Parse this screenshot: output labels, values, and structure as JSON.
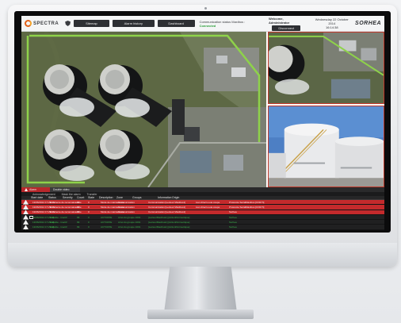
{
  "app": {
    "brand_logo": "SPECTRA",
    "vendor_logo": "SORHEA",
    "accent": "#e2621b"
  },
  "nav": {
    "synoptic": "Sitemap",
    "history": "Alarm history",
    "dashboard": "Dashboard"
  },
  "status": {
    "label": "Communication status Maxibus :",
    "value": "Connected",
    "value_color": "#2c9e3a"
  },
  "user": {
    "welcome": "Welcome, Administrator",
    "disconnect": "Disconnect"
  },
  "datetime": {
    "date": "Wednesday 22 October 2014",
    "time": "16:14:38"
  },
  "alarm_panel": {
    "tabs": [
      "Alarm",
      "Double video"
    ],
    "actions": [
      "Acknowledgement",
      "Mask the alarm",
      "Transfer"
    ],
    "columns": [
      "Start date",
      "Status",
      "Severity",
      "Count",
      "State",
      "Description",
      "Zone",
      "Groups",
      "Information",
      "Origin"
    ],
    "rows": [
      {
        "date": "13/06/2014 17:29:46",
        "status": "En attente de reconnaissance",
        "severity": "99",
        "count": "0",
        "desc": "Mode de maintenance",
        "zone": "Communication",
        "groups": "Communication [Lecteur Maxibus1]",
        "info": "Lien direct a ete coupe",
        "origin": "Protocole SerialMaxibus [COM 5]",
        "state": "active"
      },
      {
        "date": "13/06/2014 17:29:46",
        "status": "En attente de reconnaissance",
        "severity": "99",
        "count": "0",
        "desc": "Mode de maintenance",
        "zone": "Communication",
        "groups": "Communication [Lecteur Maxibus1]",
        "info": "Lien direct a ete coupe",
        "origin": "Protocole SerialMaxibus [COM 5]",
        "state": "active"
      },
      {
        "date": "13/06/2014 17:29:46",
        "status": "En attente de reconnaissance",
        "severity": "99",
        "count": "0",
        "desc": "Mode de maintenance",
        "zone": "Communication",
        "groups": "Communication [Lecteur Maxibus1]",
        "info": "",
        "origin": "Sorhea",
        "state": "active"
      },
      {
        "date": "13/06/2014 17:29:46",
        "status": "Acquitte - Inactif",
        "severity": "99",
        "count": "0",
        "desc": "ACTIVATE",
        "zone": "Arret du groupe 1001",
        "groups": "[LecteurMaxibus1] [ActionPerimetrique]",
        "info": "",
        "origin": "Sorhea",
        "state": "ack"
      },
      {
        "date": "13/06/2014 17:29:46",
        "status": "Acquitte - Inactif",
        "severity": "99",
        "count": "0",
        "desc": "ACTIVATE",
        "zone": "Arret du groupe 1001",
        "groups": "[LecteurMaxibus1] [ActionPerimetrique]",
        "info": "",
        "origin": "Sorhea",
        "state": "ack"
      },
      {
        "date": "13/06/2014 17:29:46",
        "status": "Acquitte - Inactif",
        "severity": "99",
        "count": "0",
        "desc": "ACTIVATE",
        "zone": "Arret du groupe 1001",
        "groups": "[LecteurMaxibus1] [ActionPerimetrique]",
        "info": "",
        "origin": "Sorhea",
        "state": "ack"
      },
      {
        "date": "13/06/2014 17:29:46",
        "status": "Acquitte - Inactif",
        "severity": "99",
        "count": "0",
        "desc": "ACTIVATE",
        "zone": "Arret du groupe 1001",
        "groups": "[LecteurMaxibus1] [ActionPerimetrique]",
        "info": "",
        "origin": "Sorhea",
        "state": "ack"
      }
    ]
  }
}
